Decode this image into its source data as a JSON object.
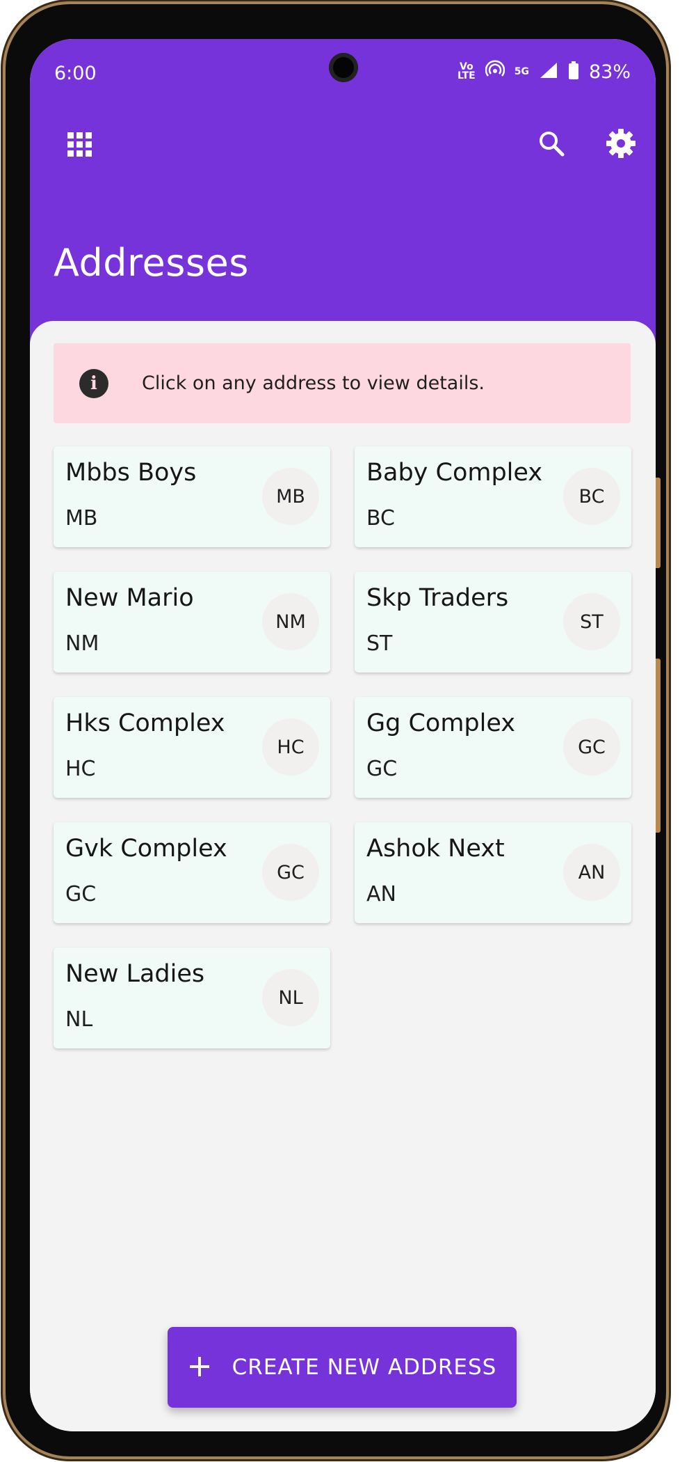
{
  "status_bar": {
    "time": "6:00",
    "volte": "Vo\nLTE",
    "network": "5G",
    "battery": "83%"
  },
  "header": {
    "title": "Addresses"
  },
  "info_banner": {
    "text": "Click on any address to view details."
  },
  "addresses": [
    {
      "name": "Mbbs Boys",
      "code": "MB"
    },
    {
      "name": "Baby Complex",
      "code": "BC"
    },
    {
      "name": "New Mario",
      "code": "NM"
    },
    {
      "name": "Skp Traders",
      "code": "ST"
    },
    {
      "name": "Hks Complex",
      "code": "HC"
    },
    {
      "name": "Gg Complex",
      "code": "GC"
    },
    {
      "name": "Gvk Complex",
      "code": "GC"
    },
    {
      "name": "Ashok Next",
      "code": "AN"
    },
    {
      "name": "New Ladies",
      "code": "NL"
    }
  ],
  "fab": {
    "label": "CREATE NEW ADDRESS"
  },
  "colors": {
    "primary": "#7633d9",
    "banner": "#fdd8e0",
    "card": "#f0fbf7"
  },
  "icons": [
    "apps-grid-icon",
    "search-icon",
    "gear-icon",
    "info-icon",
    "plus-icon"
  ]
}
